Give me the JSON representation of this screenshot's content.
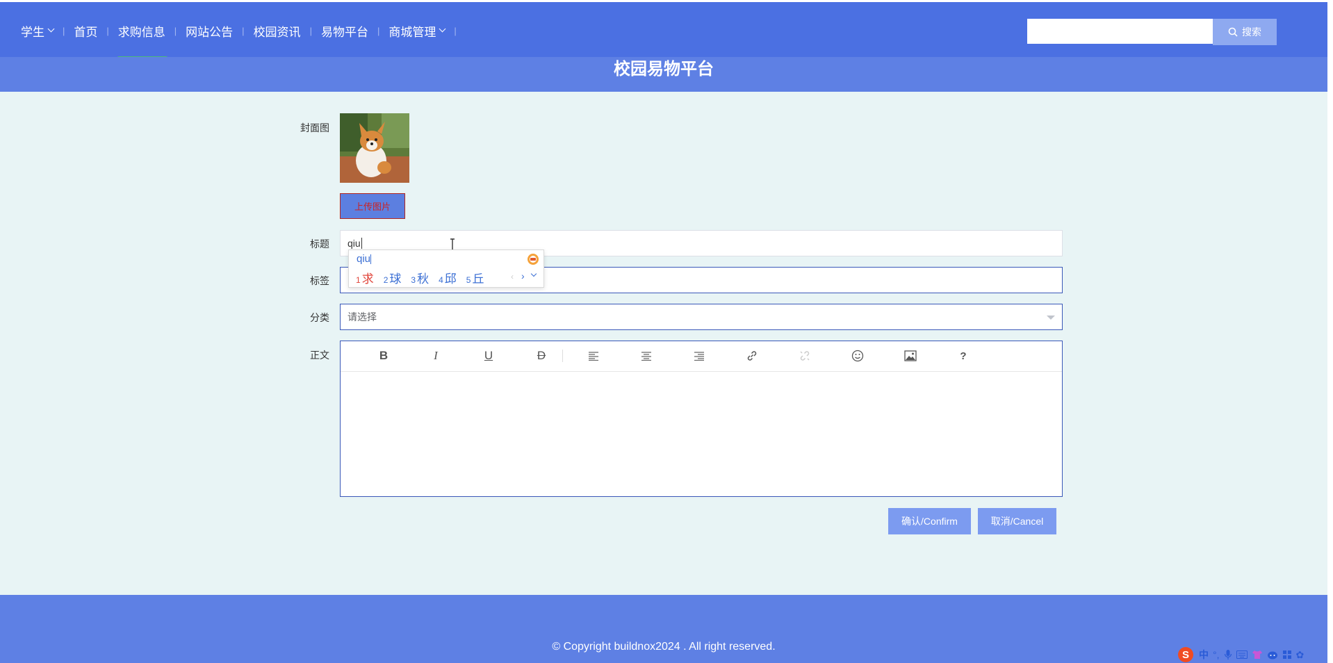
{
  "nav": {
    "items": [
      {
        "label": "学生",
        "dropdown": true
      },
      {
        "label": "首页"
      },
      {
        "label": "求购信息",
        "active": true
      },
      {
        "label": "网站公告"
      },
      {
        "label": "校园资讯"
      },
      {
        "label": "易物平台"
      },
      {
        "label": "商城管理",
        "dropdown": true
      }
    ]
  },
  "search": {
    "placeholder": "",
    "button_label": "搜索"
  },
  "banner": {
    "title": "校园易物平台"
  },
  "form": {
    "cover_label": "封面图",
    "upload_label": "上传图片",
    "title_label": "标题",
    "title_value": "qiu",
    "tags_label": "标签",
    "tags_value": "",
    "category_label": "分类",
    "category_placeholder": "请选择",
    "body_label": "正文",
    "editor_toolbar": [
      "bold-icon",
      "italic-icon",
      "underline-icon",
      "strikethrough-icon",
      "align-left-icon",
      "align-center-icon",
      "align-right-icon",
      "link-icon",
      "unlink-icon",
      "emoji-icon",
      "image-icon",
      "help-icon"
    ]
  },
  "ime": {
    "input": "qiu",
    "candidates": [
      {
        "num": "1",
        "text": "求"
      },
      {
        "num": "2",
        "text": "球"
      },
      {
        "num": "3",
        "text": "秋"
      },
      {
        "num": "4",
        "text": "邱"
      },
      {
        "num": "5",
        "text": "丘"
      }
    ]
  },
  "actions": {
    "confirm_label": "确认/Confirm",
    "cancel_label": "取消/Cancel"
  },
  "footer": {
    "copyright": "© Copyright buildnox2024 . All right reserved."
  },
  "tray": {
    "ime_mode": "中"
  },
  "colors": {
    "nav_bg": "#4b70e2",
    "banner_bg": "#5e80e4",
    "page_bg": "#e8f4f5",
    "active_underline": "#4cb87a",
    "button_bg": "#7c9bf0"
  }
}
